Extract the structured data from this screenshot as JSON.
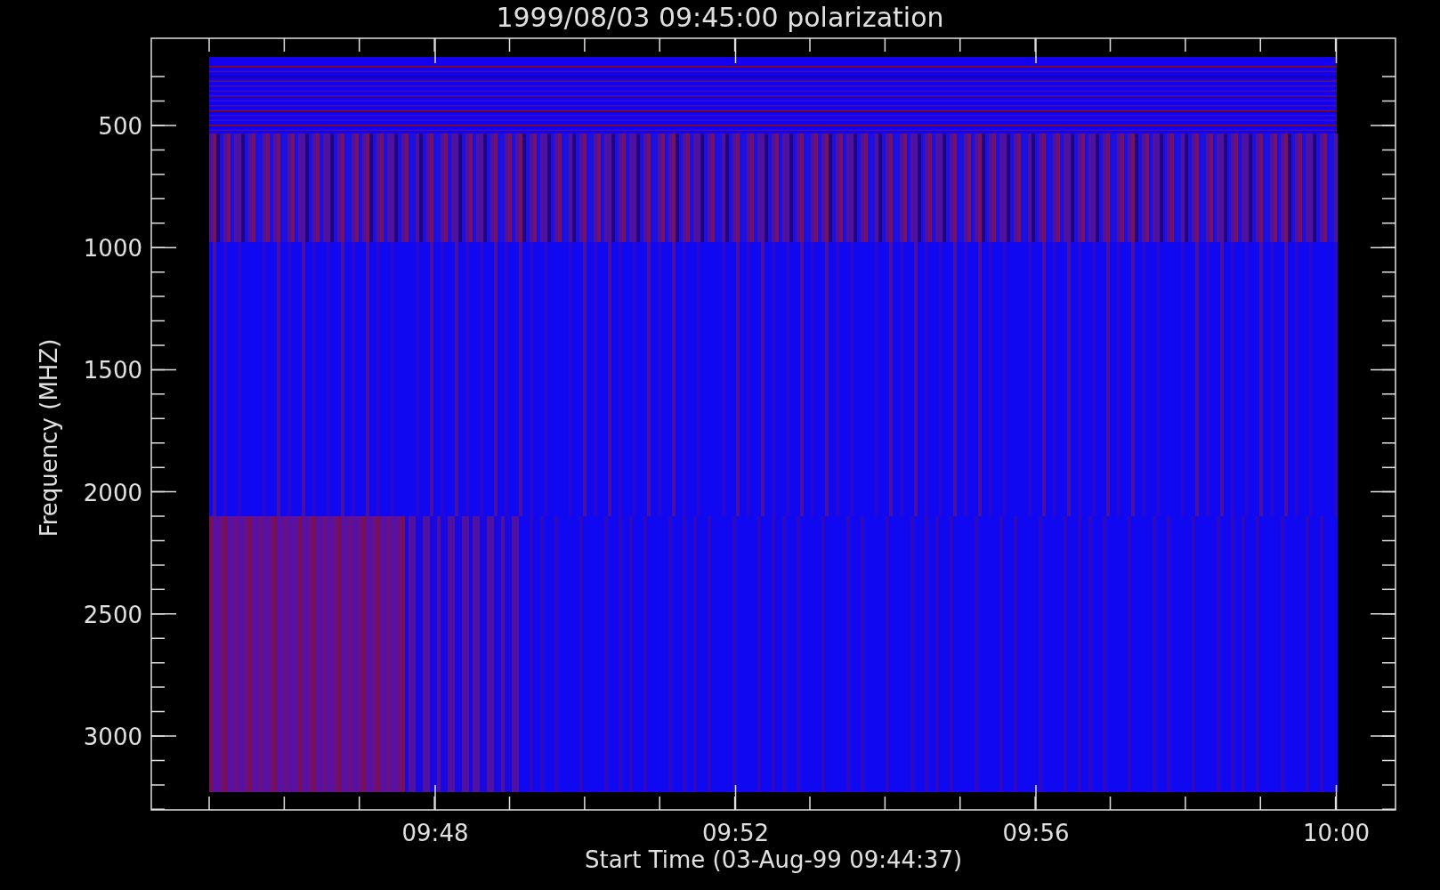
{
  "title": "1999/08/03 09:45:00 polarization",
  "y_axis": {
    "label": "Frequency (MHZ)",
    "ticks": [
      "500",
      "1000",
      "1500",
      "2000",
      "2500",
      "3000"
    ]
  },
  "x_axis": {
    "label": "Start Time (03-Aug-99 09:44:37)",
    "ticks": [
      "09:48",
      "09:52",
      "09:56",
      "10:00"
    ]
  }
}
